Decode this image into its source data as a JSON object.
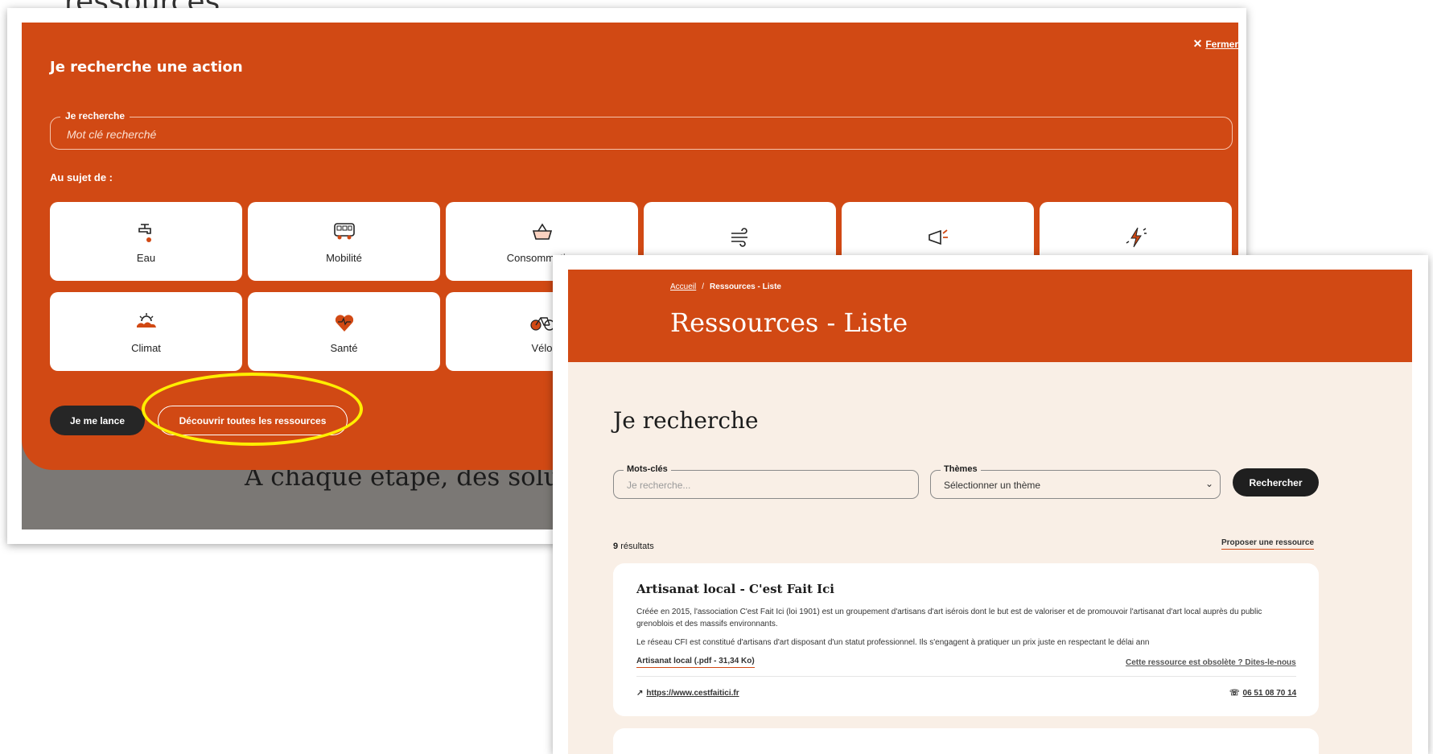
{
  "caption": "ressources",
  "modal": {
    "close_label": "Fermer",
    "title": "Je recherche une action",
    "search_legend": "Je recherche",
    "search_placeholder": "Mot clé recherché",
    "about_label": "Au sujet de :",
    "tiles": [
      {
        "label": "Eau",
        "icon": "water-tap-icon"
      },
      {
        "label": "Mobilité",
        "icon": "bus-icon"
      },
      {
        "label": "Consommation",
        "icon": "basket-icon"
      },
      {
        "label": "",
        "icon": "wind-icon"
      },
      {
        "label": "",
        "icon": "megaphone-icon"
      },
      {
        "label": "",
        "icon": "lightning-icon"
      },
      {
        "label": "Climat",
        "icon": "sun-cloud-icon"
      },
      {
        "label": "Santé",
        "icon": "heart-pulse-icon"
      },
      {
        "label": "Vélo",
        "icon": "bicycle-icon"
      }
    ],
    "primary_button": "Je me lance",
    "secondary_button": "Découvrir toutes les ressources",
    "background_heading": "À chaque étape, des solutions"
  },
  "resources": {
    "breadcrumb_home": "Accueil",
    "breadcrumb_separator": "/",
    "breadcrumb_current": "Ressources - Liste",
    "page_title": "Ressources - Liste",
    "search_title": "Je recherche",
    "keywords_legend": "Mots-clés",
    "keywords_placeholder": "Je recherche...",
    "themes_legend": "Thèmes",
    "themes_selected": "Sélectionner un thème",
    "search_button": "Rechercher",
    "results_count": "9",
    "results_label": "résultats",
    "propose_link": "Proposer une ressource",
    "card": {
      "title": "Artisanat local - C'est Fait Ici",
      "paragraph1": "Créée en 2015, l'association C'est Fait Ici (loi 1901) est un groupement d'artisans d'art isérois dont le but est de valoriser et de promouvoir l'artisanat d'art local auprès du public grenoblois et des massifs environnants.",
      "paragraph2": "Le réseau CFI est constitué d'artisans d'art disposant d'un statut professionnel. Ils s'engagent à pratiquer un prix juste en respectant le délai ann",
      "file_link": "Artisanat local (.pdf - 31,34 Ko)",
      "obsolete_link": "Cette ressource est obsolète ? Dites-le-nous",
      "website": "https://www.cestfaitici.fr",
      "phone": "06 51 08 70 14"
    }
  },
  "colors": {
    "brand_orange": "#d14914",
    "cream": "#f9efe6",
    "dark": "#1f1f1f",
    "highlight_yellow": "#ffee00"
  }
}
